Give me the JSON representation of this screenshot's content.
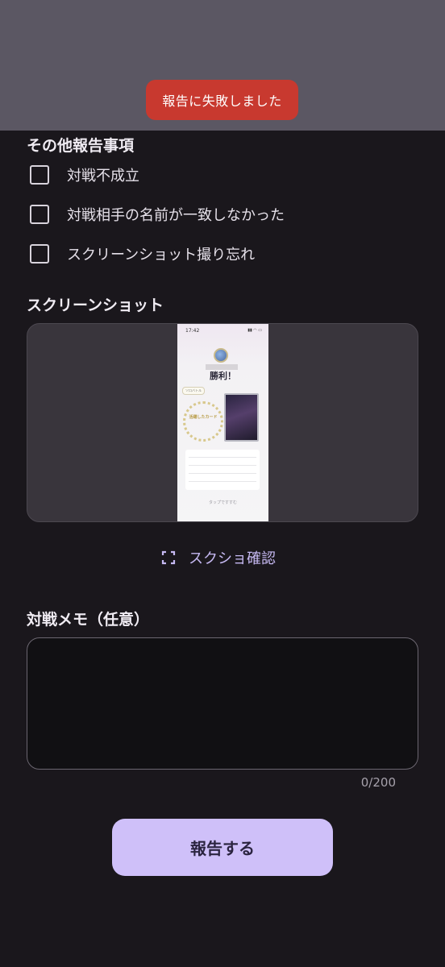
{
  "toast": {
    "message": "報告に失敗しました"
  },
  "other_report": {
    "title": "その他報告事項",
    "items": [
      {
        "label": "対戦不成立",
        "checked": false
      },
      {
        "label": "対戦相手の名前が一致しなかった",
        "checked": false
      },
      {
        "label": "スクリーンショット撮り忘れ",
        "checked": false
      }
    ]
  },
  "screenshot": {
    "title": "スクリーンショット",
    "preview": {
      "time": "17:42",
      "result": "勝利！",
      "tag": "ソロバトル",
      "card_caption": "活躍したカード",
      "footer": "タップですすむ"
    },
    "confirm_label": "スクショ確認"
  },
  "memo": {
    "title": "対戦メモ（任意）",
    "value": "",
    "placeholder": "",
    "counter": "0/200"
  },
  "submit": {
    "label": "報告する"
  },
  "colors": {
    "background": "#1a171c",
    "toast": "#c8392f",
    "accent": "#cfc0f9",
    "link": "#c6b9f2"
  }
}
